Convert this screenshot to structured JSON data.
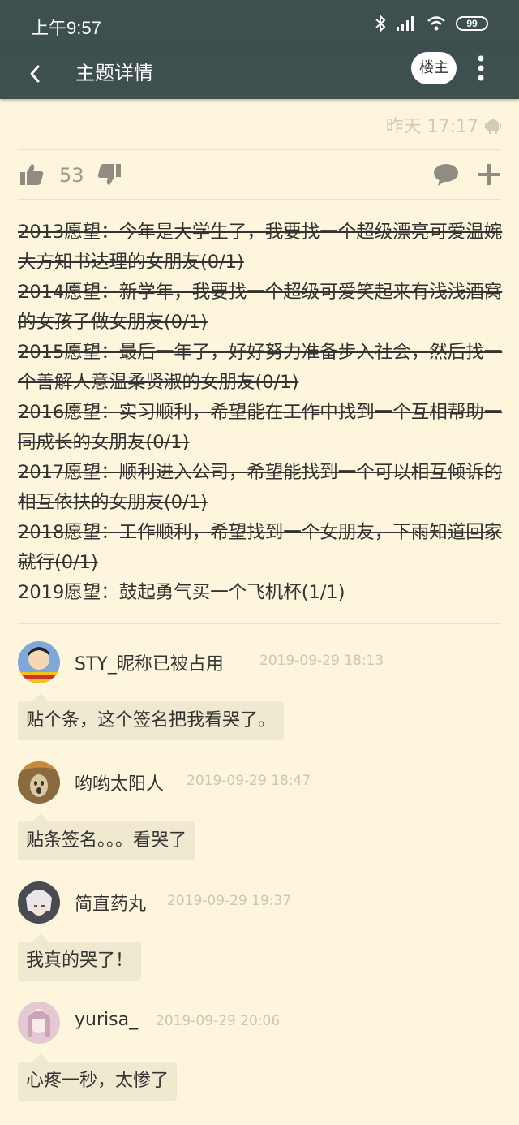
{
  "status_bar": {
    "time": "上午9:57",
    "battery": "99"
  },
  "app_bar": {
    "title": "主题详情",
    "op_badge": "楼主"
  },
  "post": {
    "time": "昨天 17:17",
    "likes": "53",
    "lines": [
      {
        "text": "2013愿望：今年是大学生了，我要找一个超级漂亮可爱温婉大方知书达理的女朋友(0/1)",
        "struck": true
      },
      {
        "text": "2014愿望：新学年，我要找一个超级可爱笑起来有浅浅酒窝的女孩子做女朋友(0/1)",
        "struck": true
      },
      {
        "text": "2015愿望：最后一年了，好好努力准备步入社会，然后找一个善解人意温柔贤淑的女朋友(0/1)",
        "struck": true
      },
      {
        "text": "2016愿望：实习顺利，希望能在工作中找到一个互相帮助一同成长的女朋友(0/1)",
        "struck": true
      },
      {
        "text": "2017愿望：顺利进入公司，希望能找到一个可以相互倾诉的相互依扶的女朋友(0/1)",
        "struck": true
      },
      {
        "text": "2018愿望：工作顺利，希望找到一个女朋友，下雨知道回家就行(0/1)",
        "struck": true
      },
      {
        "text": "2019愿望：鼓起勇气买一个飞机杯(1/1)",
        "struck": false
      }
    ]
  },
  "comments": [
    {
      "name": "STY_昵称已被占用",
      "time": "2019-09-29 18:13",
      "text": "贴个条，这个签名把我看哭了。",
      "avatar_color": "#7fa7d8"
    },
    {
      "name": "哟哟太阳人",
      "time": "2019-09-29 18:47",
      "text": "贴条签名。。。看哭了",
      "avatar_color": "#8a6a40"
    },
    {
      "name": "简直药丸",
      "time": "2019-09-29 19:37",
      "text": "我真的哭了！",
      "avatar_color": "#4a4a52"
    },
    {
      "name": "yurisa_",
      "time": "2019-09-29 20:06",
      "text": "心疼一秒，太惨了",
      "avatar_color": "#e6c8d4"
    }
  ]
}
